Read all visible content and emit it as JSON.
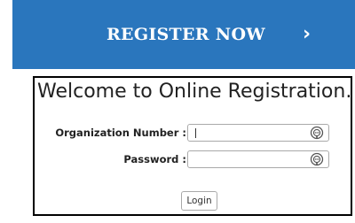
{
  "banner": {
    "label": "REGISTER NOW",
    "chevron": "›",
    "color": "#2a76bd"
  },
  "panel": {
    "title": "Welcome to Online Registration.",
    "fields": [
      {
        "label": "Organization Number :",
        "value": "",
        "placeholder": "",
        "icon": "key-icon"
      },
      {
        "label": "Password :",
        "value": "",
        "placeholder": "",
        "icon": "key-icon"
      }
    ],
    "login_label": "Login"
  }
}
